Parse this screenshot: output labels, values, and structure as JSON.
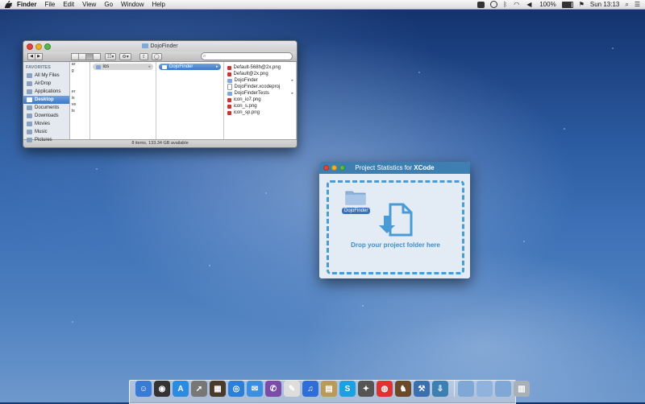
{
  "menubar": {
    "app": "Finder",
    "items": [
      "File",
      "Edit",
      "View",
      "Go",
      "Window",
      "Help"
    ],
    "battery": "100%",
    "clock": "Sun 13:13"
  },
  "finder": {
    "title": "DojoFinder",
    "search_placeholder": "",
    "sidebar": {
      "heading": "FAVORITES",
      "items": [
        {
          "label": "All My Files",
          "icon": "all-files-icon"
        },
        {
          "label": "AirDrop",
          "icon": "airdrop-icon"
        },
        {
          "label": "Applications",
          "icon": "applications-icon"
        },
        {
          "label": "Desktop",
          "icon": "desktop-icon"
        },
        {
          "label": "Documents",
          "icon": "documents-icon"
        },
        {
          "label": "Downloads",
          "icon": "downloads-icon"
        },
        {
          "label": "Movies",
          "icon": "movies-icon"
        },
        {
          "label": "Music",
          "icon": "music-icon"
        },
        {
          "label": "Pictures",
          "icon": "pictures-icon"
        }
      ]
    },
    "col0_text": [
      "ar",
      "g",
      "",
      "",
      "er",
      "is",
      "ve",
      "ts"
    ],
    "col1": [
      {
        "label": "ios"
      }
    ],
    "col2": [
      {
        "label": "DojoFinder"
      }
    ],
    "col3": [
      {
        "label": "Default-568h@2x.png",
        "kind": "img"
      },
      {
        "label": "Default@2x.png",
        "kind": "img"
      },
      {
        "label": "DojoFinder",
        "kind": "folder",
        "chev": "▸"
      },
      {
        "label": "DojoFinder.xcodeproj",
        "kind": "file"
      },
      {
        "label": "DojoFinderTests",
        "kind": "folder",
        "chev": "▸"
      },
      {
        "label": "icon_io7.png",
        "kind": "img"
      },
      {
        "label": "icon_s.png",
        "kind": "img"
      },
      {
        "label": "icon_sp.png",
        "kind": "img"
      }
    ],
    "status": "8 items, 133.34 GB available"
  },
  "stats_window": {
    "title_prefix": "Project Statistics for ",
    "title_bold": "XCode",
    "folder_label": "DojoFinder",
    "drop_text": "Drop your project folder here"
  },
  "dock": {
    "icons": [
      {
        "name": "finder-icon",
        "color": "#3a7bd5",
        "glyph": "☺"
      },
      {
        "name": "dashboard-icon",
        "color": "#333",
        "glyph": "◉"
      },
      {
        "name": "app-store-icon",
        "color": "#2a8be0",
        "glyph": "A"
      },
      {
        "name": "launchpad-icon",
        "color": "#777",
        "glyph": "➚"
      },
      {
        "name": "photo-icon",
        "color": "#4a3a2a",
        "glyph": "▦"
      },
      {
        "name": "safari-icon",
        "color": "#2b7fd6",
        "glyph": "◎"
      },
      {
        "name": "messages-icon",
        "color": "#3b8ee0",
        "glyph": "✉"
      },
      {
        "name": "viber-icon",
        "color": "#7b4ba8",
        "glyph": "✆"
      },
      {
        "name": "textedit-icon",
        "color": "#ddd",
        "glyph": "✎"
      },
      {
        "name": "music-icon",
        "color": "#2e6ed6",
        "glyph": "♫"
      },
      {
        "name": "preview-icon",
        "color": "#b89a5a",
        "glyph": "▤"
      },
      {
        "name": "skype-icon",
        "color": "#1ea0e0",
        "glyph": "S"
      },
      {
        "name": "penguin-icon",
        "color": "#555",
        "glyph": "✦"
      },
      {
        "name": "lifebuoy-icon",
        "color": "#d33",
        "glyph": "◍"
      },
      {
        "name": "chess-icon",
        "color": "#6b4a2a",
        "glyph": "♞"
      },
      {
        "name": "xcode-icon",
        "color": "#3a6fb0",
        "glyph": "⚒"
      },
      {
        "name": "project-stats-icon",
        "color": "#3e7fb2",
        "glyph": "⇩"
      },
      {
        "name": "separator",
        "color": "",
        "glyph": ""
      },
      {
        "name": "folder-icon",
        "color": "#7fa8d6",
        "glyph": ""
      },
      {
        "name": "folder-icon",
        "color": "#8fb3dd",
        "glyph": ""
      },
      {
        "name": "folder-icon",
        "color": "#7fa8d6",
        "glyph": ""
      },
      {
        "name": "trash-icon",
        "color": "#aab0b8",
        "glyph": "▥"
      }
    ]
  }
}
